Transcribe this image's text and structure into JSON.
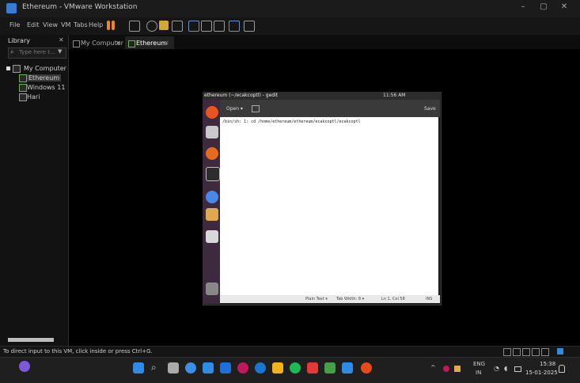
{
  "window": {
    "title": "Ethereum - VMware Workstation",
    "controls": [
      "–",
      "▢",
      "✕"
    ]
  },
  "menu": [
    "File",
    "Edit",
    "View",
    "VM",
    "Tabs",
    "Help"
  ],
  "library": {
    "title": "Library",
    "close": "✕",
    "search_placeholder": "Type here t...",
    "tree": {
      "root": "My Computer",
      "items": [
        "Ethereum",
        "Windows 11",
        "Hari"
      ]
    }
  },
  "tabs": [
    {
      "label": "My Computer",
      "close": "✕"
    },
    {
      "label": "Ethereum",
      "close": "✕"
    }
  ],
  "gedit": {
    "title": "ethereum (~/ecakcoptl) - gedit",
    "tray_time": "11:56 AM",
    "open_label": "Open ▾",
    "save_label": "Save",
    "text": "/bin/sh: 1: cd /home/ethereum/ethereum/ecakcoptl/ecakcoptl",
    "status": {
      "mode": "Plain Text ▾",
      "tab_width": "Tab Width: 8 ▾",
      "position": "Ln 1, Col 58",
      "ins": "INS"
    }
  },
  "vm_status": "To direct input to this VM, click inside or press Ctrl+G.",
  "taskbar": {
    "tray": {
      "chevron": "^",
      "lang_top": "ENG",
      "lang_bottom": "IN",
      "time": "15:38",
      "date": "15-01-2025"
    }
  },
  "colors": {
    "accent": "#3a7bd5",
    "ubuntu_launcher": "#3d2a3e",
    "pause_orange": "#e88b1a"
  }
}
